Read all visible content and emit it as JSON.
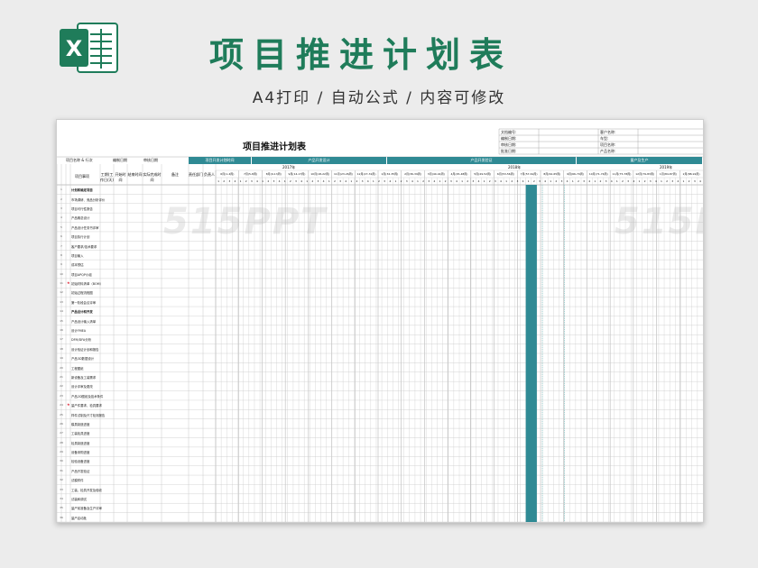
{
  "app": {
    "icon_letter": "X",
    "title": "项目推进计划表",
    "subtitle": "A4打印 / 自动公式 / 内容可修改"
  },
  "sheet": {
    "title": "项目推进计划表",
    "info_left": [
      "文档编号:",
      "编制日期:",
      "审核日期:",
      "批准日期:"
    ],
    "info_right": [
      "客户名称:",
      "车型:",
      "项目名称:",
      "产品名称:"
    ],
    "watermark": "515PPT",
    "top_left": [
      "项目名称 & 行次",
      "编制日期",
      "审核日期"
    ],
    "bands": [
      "项目开发计划时间",
      "产品开发设计",
      "产品开发验证",
      "量产及生产"
    ],
    "years": [
      "2017年",
      "2018年",
      "2019年"
    ],
    "col_headers": [
      "工期(工作日/天)",
      "开始时间",
      "结束时间",
      "实际完成时间",
      "备注",
      "责任部门",
      "负责人"
    ],
    "months": [
      "6月(1-4周)",
      "7月(5-8周)",
      "8月(9-13周)",
      "9月(14-17周)",
      "10月(18-22周)",
      "11月(23-26周)",
      "12月(27-31周)",
      "1月(32-35周)",
      "2月(36-39周)",
      "3月(40-44周)",
      "4月(45-48周)",
      "5月(49-52周)",
      "6月(53-56周)",
      "7月(57-61周)",
      "8月(62-65周)",
      "9月(66-70周)",
      "10月(71-74周)",
      "11月(75-78周)",
      "12月(79-83周)",
      "1月(84-87周)",
      "2月(88-91周)"
    ],
    "rows": [
      {
        "label": "计划和确定项目",
        "bold": true
      },
      {
        "label": "市场调研、竞品分析评价"
      },
      {
        "label": "项目可行性报告"
      },
      {
        "label": "产品概念设计"
      },
      {
        "label": "产品设计任务书评审"
      },
      {
        "label": "项目执行计划"
      },
      {
        "label": "客户要求/技术要求"
      },
      {
        "label": "项目输入"
      },
      {
        "label": "成本预估"
      },
      {
        "label": "项目APQP小组"
      },
      {
        "label": "初始材料清单（BOM）"
      },
      {
        "label": "初始过程流程图"
      },
      {
        "label": "第一阶段会议评审"
      },
      {
        "label": "产品设计和开发",
        "bold": true
      },
      {
        "label": "产品设计输入清单"
      },
      {
        "label": "设计FMEA"
      },
      {
        "label": "DFM/DFA分析"
      },
      {
        "label": "设计验证计划和报告"
      },
      {
        "label": "产品3D数据设计"
      },
      {
        "label": "工程图纸"
      },
      {
        "label": "新设备及工装需求"
      },
      {
        "label": "设计评审及更改"
      },
      {
        "label": "产品2D图纸及技术条件"
      },
      {
        "label": "量产件要求、检具要求"
      },
      {
        "label": "样件试制及尺寸检测报告"
      },
      {
        "label": "模具制造进度"
      },
      {
        "label": "工装检具进度"
      },
      {
        "label": "检具制造进度"
      },
      {
        "label": "设备采购进度"
      },
      {
        "label": "检验设备进度"
      },
      {
        "label": "产品开发验证"
      },
      {
        "label": "试模样件"
      },
      {
        "label": "工装、检具开发及验收"
      },
      {
        "label": "试装和调试"
      },
      {
        "label": "量产前准备及生产评审"
      },
      {
        "label": "量产启动批"
      }
    ],
    "colors": {
      "band": "#2f8a94",
      "highlight": "#2f8a94",
      "grid": "#c8c8c8",
      "title_green": "#1f7c5a",
      "lines": [
        "#7fc6c6",
        "#e07a3a",
        "#8a5cc8",
        "#3ab06a",
        "#d04060"
      ]
    }
  }
}
